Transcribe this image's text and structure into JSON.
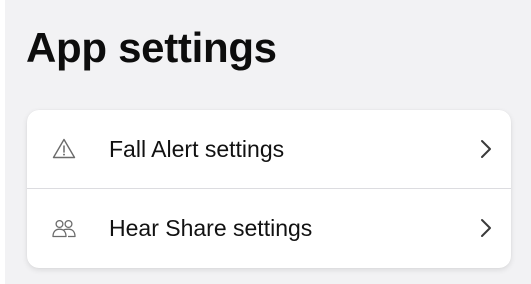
{
  "header": {
    "title": "App settings"
  },
  "settings": {
    "items": [
      {
        "label": "Fall Alert settings",
        "icon": "warning-triangle-icon"
      },
      {
        "label": "Hear Share settings",
        "icon": "people-icon"
      }
    ]
  },
  "colors": {
    "background": "#f2f2f4",
    "card": "#ffffff",
    "text": "#111111",
    "icon": "#6b6b6b",
    "divider": "#dcdce0"
  }
}
